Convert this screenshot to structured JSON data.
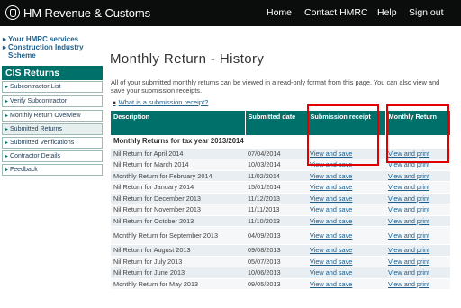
{
  "header": {
    "brand": "HM Revenue & Customs",
    "nav": [
      "Home",
      "Contact HMRC",
      "Help",
      "Sign out"
    ]
  },
  "sidebar": {
    "top_links": [
      "Your HMRC services",
      "Construction Industry Scheme"
    ],
    "section_title": "CIS Returns",
    "items": [
      "Subcontractor List",
      "Verify Subcontractor",
      "Monthly Return Overview",
      "Submitted Returns",
      "Submitted Verifications",
      "Contractor Details",
      "Feedback"
    ],
    "active_item": "Submitted Returns"
  },
  "main": {
    "title": "Monthly Return - History",
    "intro": "All of your submitted monthly returns can be viewed in a read-only format from this page. You can also view and save your submission receipts.",
    "help_link": "What is a submission receipt?",
    "columns": [
      "Description",
      "Submitted date",
      "Submission receipt",
      "Monthly Return"
    ],
    "group_heading": "Monthly Returns for tax year 2013/2014",
    "rows": [
      {
        "description": "Nil Return for April 2014",
        "date": "07/04/2014",
        "receipt": "View and save",
        "return": "View and print"
      },
      {
        "description": "Nil Return for March 2014",
        "date": "10/03/2014",
        "receipt": "View and save",
        "return": "View and print"
      },
      {
        "description": "Monthly Return for February 2014",
        "date": "11/02/2014",
        "receipt": "View and save",
        "return": "View and print"
      },
      {
        "description": "Nil Return for January 2014",
        "date": "15/01/2014",
        "receipt": "View and save",
        "return": "View and print"
      },
      {
        "description": "Nil Return for December 2013",
        "date": "11/12/2013",
        "receipt": "View and save",
        "return": "View and print"
      },
      {
        "description": "Nil Return for November 2013",
        "date": "11/11/2013",
        "receipt": "View and save",
        "return": "View and print"
      },
      {
        "description": "Nil Return for October 2013",
        "date": "11/10/2013",
        "receipt": "View and save",
        "return": "View and print"
      },
      {
        "description": "Monthly Return for September 2013",
        "date": "04/09/2013",
        "receipt": "View and save",
        "return": "View and print"
      },
      {
        "description": "Nil Return for August 2013",
        "date": "09/08/2013",
        "receipt": "View and save",
        "return": "View and print"
      },
      {
        "description": "Nil Return for July 2013",
        "date": "05/07/2013",
        "receipt": "View and save",
        "return": "View and print"
      },
      {
        "description": "Nil Return for June 2013",
        "date": "10/06/2013",
        "receipt": "View and save",
        "return": "View and print"
      },
      {
        "description": "Monthly Return for May 2013",
        "date": "09/05/2013",
        "receipt": "View and save",
        "return": "View and print"
      }
    ]
  },
  "colors": {
    "header_bg": "#0b0c0c",
    "accent": "#00706a",
    "link": "#1f5f8a",
    "highlight": "#e00000"
  }
}
